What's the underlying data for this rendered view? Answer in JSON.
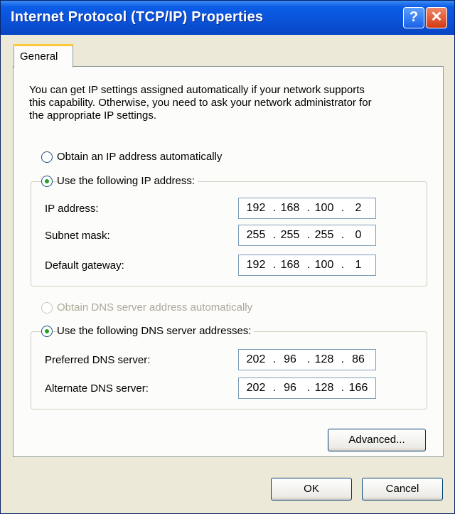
{
  "window": {
    "title": "Internet Protocol (TCP/IP) Properties",
    "help_glyph": "?",
    "close_glyph": "✕"
  },
  "tabs": [
    {
      "label": "General",
      "selected": true
    }
  ],
  "description": [
    "You can get IP settings assigned automatically if your network supports",
    "this capability. Otherwise, you need to ask your network administrator for",
    "the appropriate IP settings."
  ],
  "ip": {
    "auto_label": "Obtain an IP address automatically",
    "auto_selected": false,
    "manual_label": "Use the following IP address:",
    "manual_selected": true,
    "fields": [
      {
        "label": "IP address:",
        "octets": [
          "192",
          "168",
          "100",
          "2"
        ]
      },
      {
        "label": "Subnet mask:",
        "octets": [
          "255",
          "255",
          "255",
          "0"
        ]
      },
      {
        "label": "Default gateway:",
        "octets": [
          "192",
          "168",
          "100",
          "1"
        ]
      }
    ]
  },
  "dns": {
    "auto_label": "Obtain DNS server address automatically",
    "auto_selected": false,
    "auto_enabled": false,
    "manual_label": "Use the following DNS server addresses:",
    "manual_selected": true,
    "fields": [
      {
        "label": "Preferred DNS server:",
        "octets": [
          "202",
          "96",
          "128",
          "86"
        ]
      },
      {
        "label": "Alternate DNS server:",
        "octets": [
          "202",
          "96",
          "128",
          "166"
        ]
      }
    ]
  },
  "buttons": {
    "advanced": "Advanced...",
    "ok": "OK",
    "cancel": "Cancel"
  },
  "colors": {
    "titlebar": "#0a52d8",
    "window_bg": "#ece9d8",
    "panel_bg": "#fcfcfa",
    "radio_dot": "#21a121",
    "close_button": "#d43a12"
  }
}
